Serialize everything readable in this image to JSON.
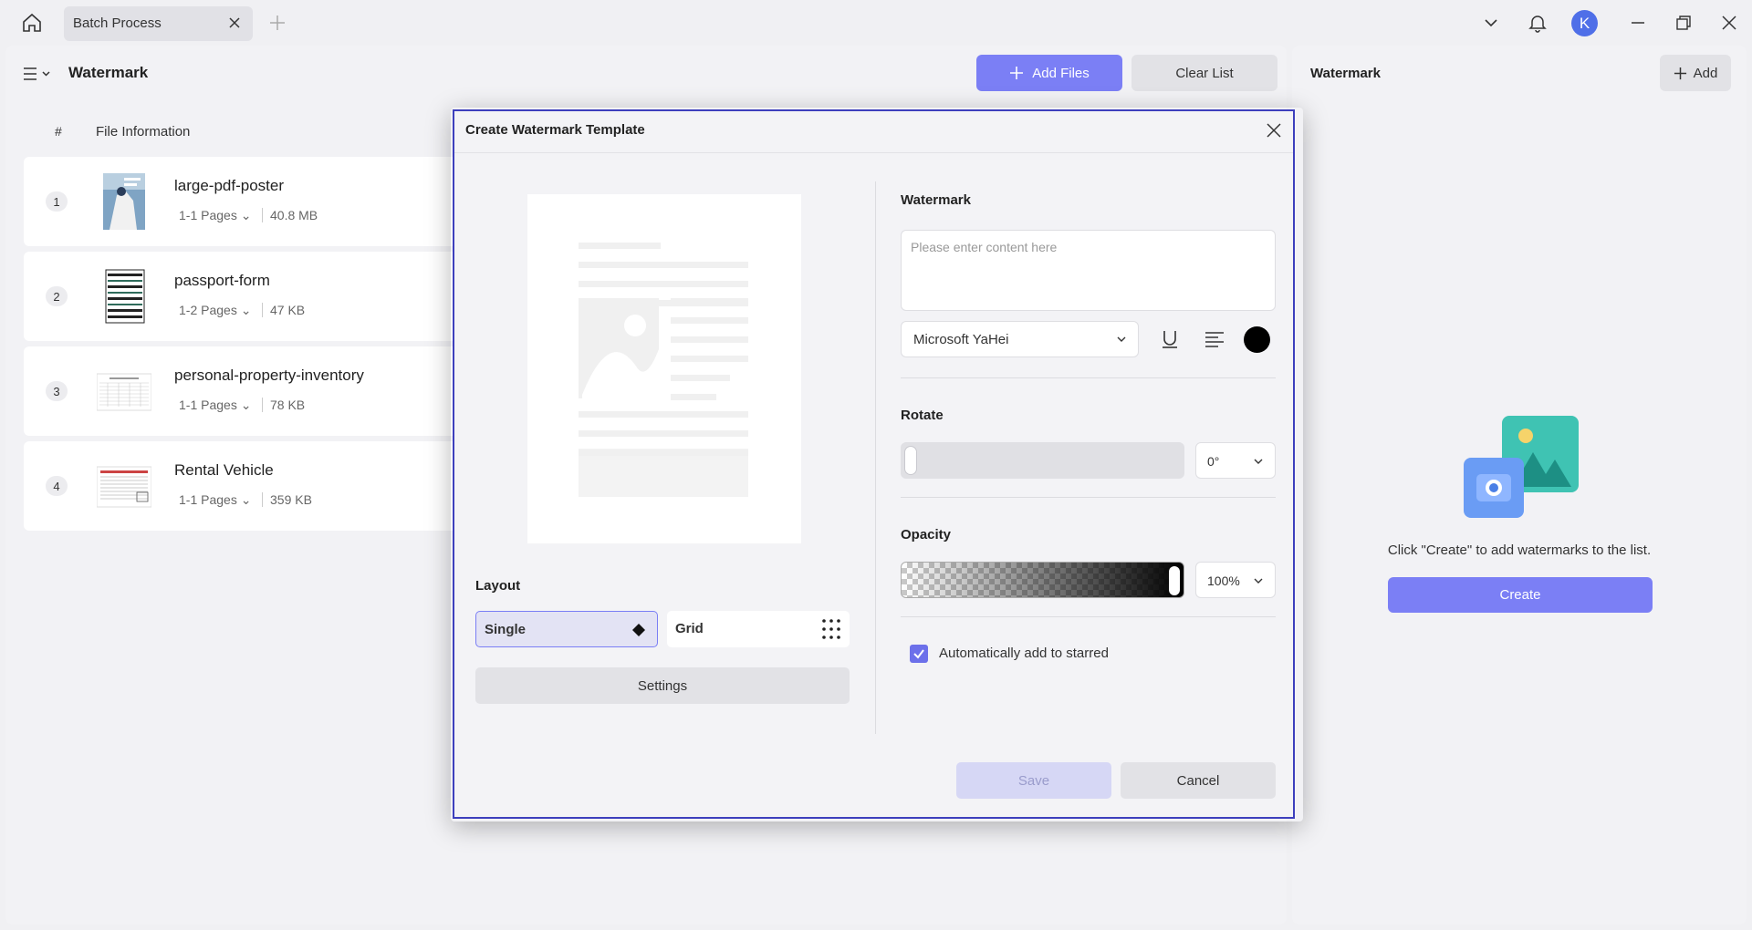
{
  "titlebar": {
    "tab_label": "Batch Process",
    "avatar_letter": "K"
  },
  "main": {
    "title": "Watermark",
    "add_files_label": "Add Files",
    "clear_list_label": "Clear List",
    "columns": {
      "num": "#",
      "info": "File Information"
    },
    "files": [
      {
        "index": "1",
        "name": "large-pdf-poster",
        "pages": "1-1 Pages",
        "size": "40.8 MB"
      },
      {
        "index": "2",
        "name": "passport-form",
        "pages": "1-2 Pages",
        "size": "47 KB"
      },
      {
        "index": "3",
        "name": "personal-property-inventory",
        "pages": "1-1 Pages",
        "size": "78 KB"
      },
      {
        "index": "4",
        "name": "Rental Vehicle",
        "pages": "1-1 Pages",
        "size": "359 KB"
      }
    ]
  },
  "right": {
    "title": "Watermark",
    "add_label": "Add",
    "empty_message": "Click \"Create\" to add watermarks to the list.",
    "create_label": "Create"
  },
  "modal": {
    "title": "Create Watermark Template",
    "layout_label": "Layout",
    "layout_single": "Single",
    "layout_grid": "Grid",
    "settings_label": "Settings",
    "watermark_label": "Watermark",
    "content_placeholder": "Please enter content here",
    "font_name": "Microsoft YaHei",
    "text_color": "#000000",
    "rotate_label": "Rotate",
    "rotate_value": "0°",
    "opacity_label": "Opacity",
    "opacity_value": "100%",
    "auto_star_label": "Automatically add to starred",
    "auto_star_checked": true,
    "save_label": "Save",
    "cancel_label": "Cancel"
  },
  "colors": {
    "accent": "#7b7ff5",
    "modal_border": "#3d3fbd",
    "avatar": "#4f6fe8"
  }
}
